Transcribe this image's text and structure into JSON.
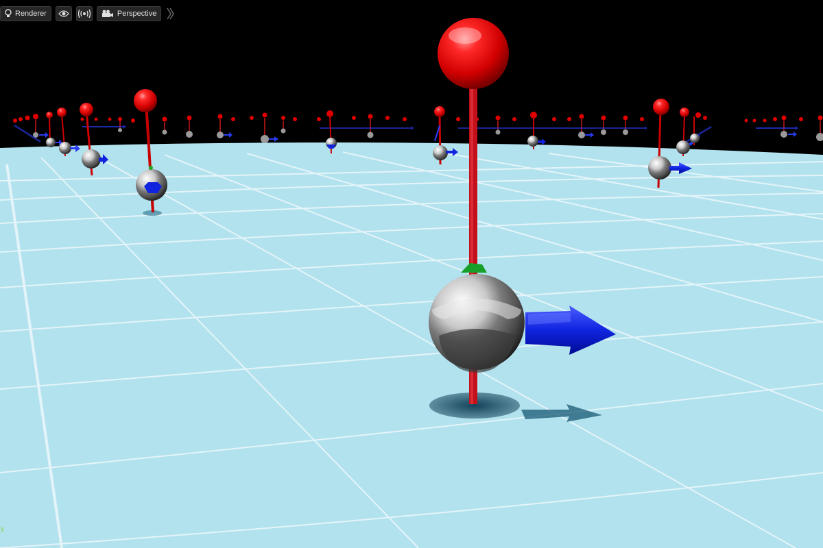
{
  "toolbar": {
    "renderer_label": "Renderer",
    "view_icon": "eye-icon",
    "realtime_icon": "broadcast-icon",
    "camera_icon": "camera-icon",
    "perspective_label": "Perspective",
    "more_icon": "double-chevron-icon"
  },
  "viewport": {
    "floor_color": "#b2e2ee",
    "sky_color": "#000000",
    "axis_indicator": "y"
  }
}
